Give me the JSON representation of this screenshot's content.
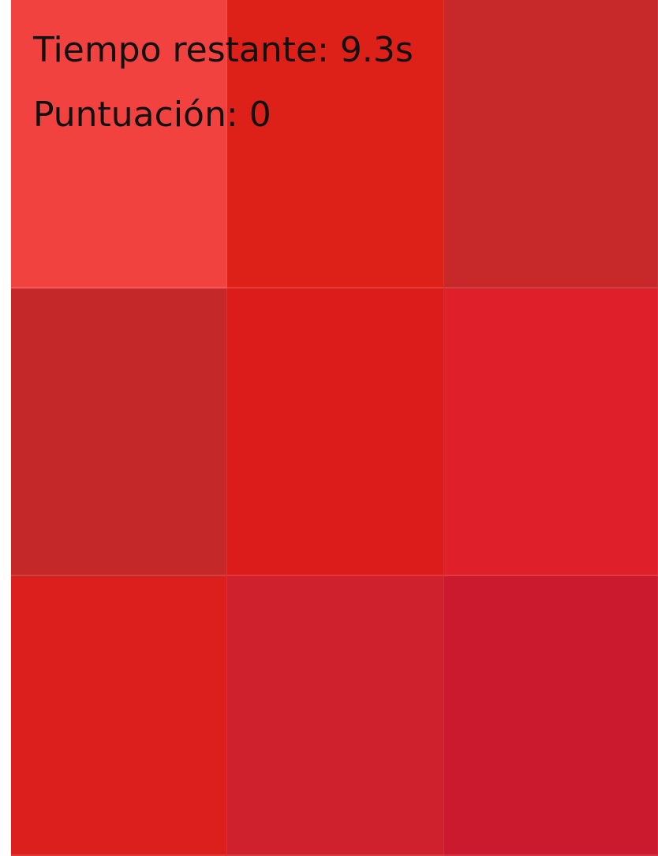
{
  "hud": {
    "time_label": "Tiempo restante:",
    "time_value": "9.3s",
    "score_label": "Puntuación:",
    "score_value": "0"
  },
  "tiles": [
    {
      "color": "#f2423f"
    },
    {
      "color": "#dd2119"
    },
    {
      "color": "#c7282a"
    },
    {
      "color": "#c52829"
    },
    {
      "color": "#dc1b1b"
    },
    {
      "color": "#df1f2a"
    },
    {
      "color": "#dc1e1d"
    },
    {
      "color": "#ce202d"
    },
    {
      "color": "#cb1a2d"
    }
  ]
}
